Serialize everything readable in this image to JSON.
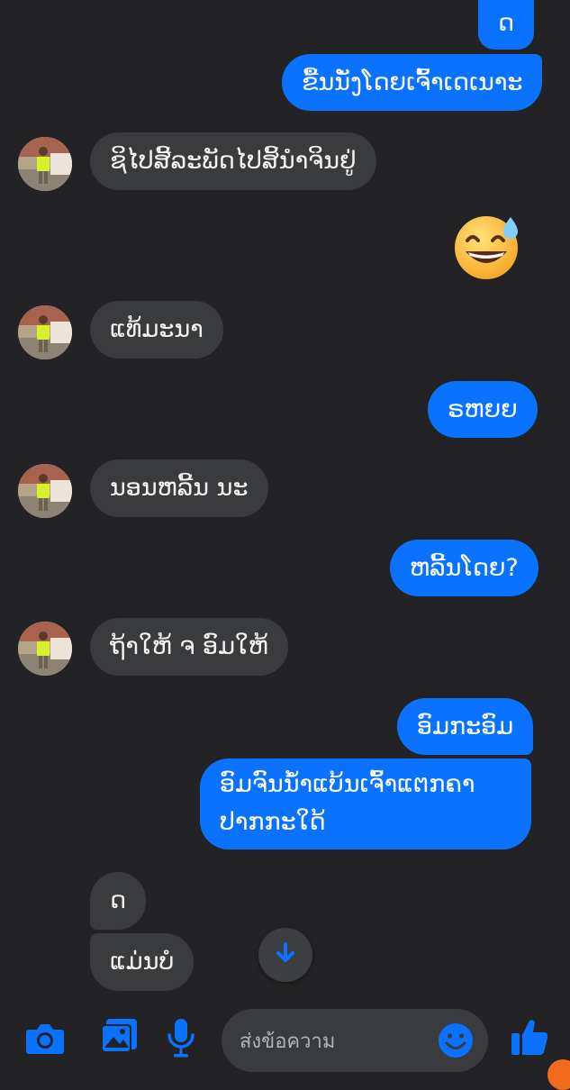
{
  "conversation": {
    "messages": [
      {
        "from": "me",
        "text": "ດ"
      },
      {
        "from": "me",
        "text": "ຂື້ນນັ່ງໂດຍເຈົ້າເດເນາະ"
      },
      {
        "from": "them",
        "text": "ຊິໄປສີ້ລະພັດໄປສິ້ນຳຈິນຢູ່"
      },
      {
        "from": "me",
        "emoji": "grinning-face-with-sweat"
      },
      {
        "from": "them",
        "text": "ແທ້ມະນາ"
      },
      {
        "from": "me",
        "text": "ຣຫຍຍ"
      },
      {
        "from": "them",
        "text": "ນອນຫລີ້ນ ນະ"
      },
      {
        "from": "me",
        "text": "ຫລີ້ນໂດຍ?"
      },
      {
        "from": "them",
        "text": "ຖ້າໃຫ້ ຈ ອົມໃຫ້"
      },
      {
        "from": "me",
        "text": "ອົມກະອົມ"
      },
      {
        "from": "me",
        "text": "ອົມຈົນນໍ້າແບ້ນເຈົ້າແຕກຄາປາກກະໃດ້"
      },
      {
        "from": "them",
        "text": "ດ"
      },
      {
        "from": "them",
        "text": "ແມ່ນບໍ"
      }
    ]
  },
  "composer": {
    "placeholder": "ส่งข้อความ",
    "tools": [
      "camera-icon",
      "photo-gallery-icon",
      "microphone-icon"
    ],
    "emoji_button": "emoji-icon",
    "like_button": "thumbs-up-icon"
  },
  "scroll_down": "arrow-down-icon",
  "colors": {
    "background": "#232325",
    "outgoing_bubble": "#0a72ff",
    "incoming_bubble": "#3a3b3d",
    "accent": "#0a72ff"
  }
}
